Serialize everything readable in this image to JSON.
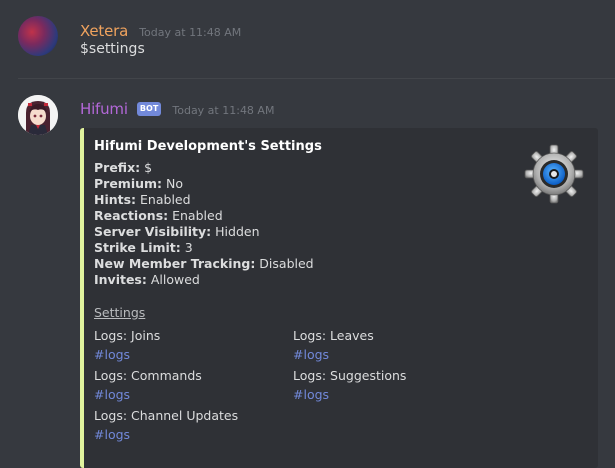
{
  "messages": [
    {
      "username": "Xetera",
      "username_color": "#f0a35e",
      "timestamp": "Today at 11:48 AM",
      "content": "$settings"
    },
    {
      "username": "Hifumi",
      "username_color": "#b368d8",
      "bot_tag": "BOT",
      "timestamp": "Today at 11:48 AM",
      "embed": {
        "accent_color": "#e1f39e",
        "title": "Hifumi Development's Settings",
        "thumbnail_icon": "gear-icon",
        "lines": [
          {
            "key": "Prefix:",
            "value": " $"
          },
          {
            "key": "Premium:",
            "value": " No"
          },
          {
            "key": "Hints:",
            "value": " Enabled"
          },
          {
            "key": "Reactions:",
            "value": " Enabled"
          },
          {
            "key": "Server Visibility:",
            "value": " Hidden"
          },
          {
            "key": "Strike Limit:",
            "value": " 3"
          },
          {
            "key": "New Member Tracking:",
            "value": " Disabled"
          },
          {
            "key": "Invites:",
            "value": " Allowed"
          }
        ],
        "settings_link": "Settings",
        "fields": [
          {
            "name": "Logs: Joins",
            "value": "#logs"
          },
          {
            "name": "Logs: Leaves",
            "value": "#logs"
          },
          {
            "name": "Logs: Commands",
            "value": "#logs"
          },
          {
            "name": "Logs: Suggestions",
            "value": "#logs"
          },
          {
            "name": "Logs: Channel Updates",
            "value": "#logs"
          }
        ]
      }
    }
  ]
}
